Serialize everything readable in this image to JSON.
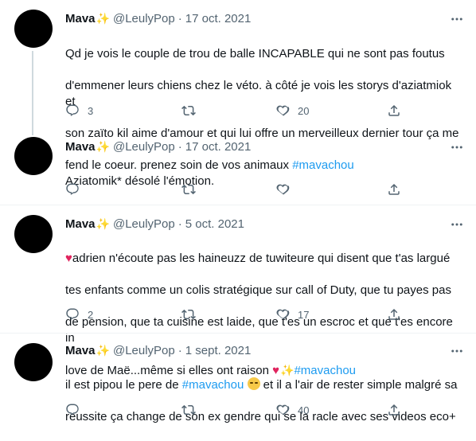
{
  "tweets": [
    {
      "name": "Mava",
      "handle": "@LeulyPop",
      "date": "17 oct. 2021",
      "lines": [
        "Qd je vois le couple de trou de balle INCAPABLE qui ne sont pas foutus",
        "d'emmener leurs chiens chez le véto. à côté je vois les storys d'aziatmiok et",
        "son zaïto kil aime d'amour et qui lui offre un merveilleux dernier tour ça me",
        "fend le coeur. prenez soin de vos animaux "
      ],
      "hashtag": "#mavachou",
      "replies": "3",
      "retweets": "",
      "likes": "20"
    },
    {
      "name": "Mava",
      "handle": "@LeulyPop",
      "date": "17 oct. 2021",
      "text": "Aziatomik* désolé l'émotion.",
      "replies": "",
      "retweets": "",
      "likes": ""
    },
    {
      "name": "Mava",
      "handle": "@LeulyPop",
      "date": "5 oct. 2021",
      "line1": "adrien n'écoute pas les haineuzz de tuwiteure qui disent que t'as largué",
      "line2": "tes enfants comme un colis stratégique sur call of Duty, que tu payes pas",
      "line3": "de pension, que ta cuisine est laide, que t'es un escroc et que t'es encore in",
      "line4": "love de Maë...même si elles ont raison ",
      "hashtag": "#mavachou",
      "replies": "2",
      "retweets": "",
      "likes": "17"
    },
    {
      "name": "Mava",
      "handle": "@LeulyPop",
      "date": "1 sept. 2021",
      "pre": "il est pipou le pere de ",
      "hashtag": "#mavachou",
      "post": " et il a l'air de rester simple malgré sa",
      "line2": "reussite ça change de son ex gendre qui se la racle avec ses videos eco+",
      "replies": "",
      "retweets": "",
      "likes": "40"
    }
  ],
  "dot": "·",
  "icons": {
    "more": "more-icon",
    "reply": "reply-icon",
    "retweet": "retweet-icon",
    "like": "like-icon",
    "share": "share-icon",
    "sparkle": "sparkle-icon",
    "heart": "heart-emoji-icon",
    "face": "relieved-face-icon"
  },
  "colors": {
    "text": "#0f1419",
    "muted": "#536471",
    "link": "#1d9bf0",
    "divider": "#eff3f4",
    "thread": "#cfd9de"
  }
}
